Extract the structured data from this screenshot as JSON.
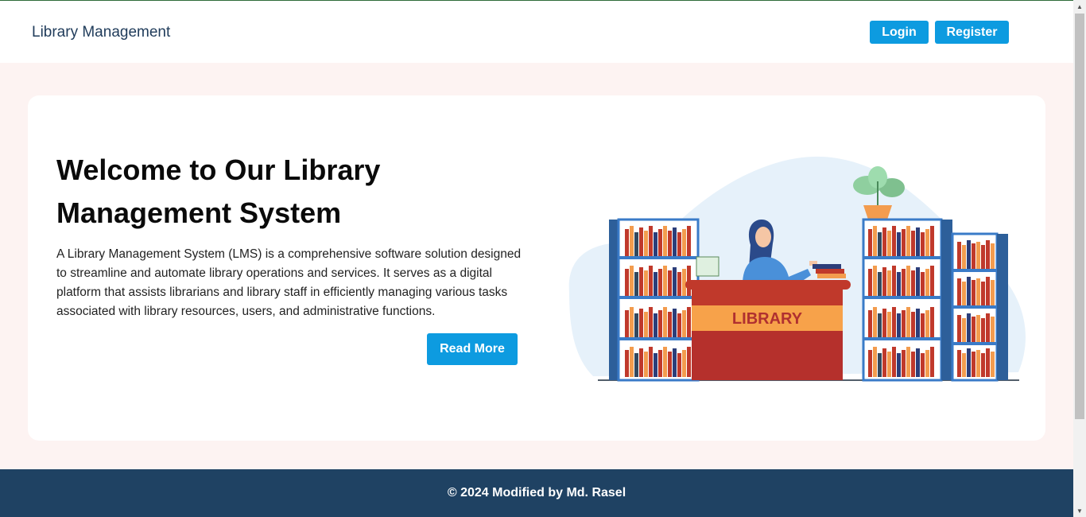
{
  "navbar": {
    "brand": "Library Management",
    "login_label": "Login",
    "register_label": "Register"
  },
  "hero": {
    "title": "Welcome to Our Library Management System",
    "description": "A Library Management System (LMS) is a comprehensive software solution designed to streamline and automate library operations and services. It serves as a digital platform that assists librarians and library staff in efficiently managing various tasks associated with library resources, users, and administrative functions.",
    "read_more_label": "Read More",
    "illustration": {
      "desk_label": "LIBRARY"
    }
  },
  "footer": {
    "text": "© 2024 Modified by Md. Rasel"
  },
  "colors": {
    "accent": "#0d9be0",
    "footer_bg": "#1f4263",
    "hero_bg": "#fdf3f2",
    "brand_text": "#1f3b5a"
  }
}
